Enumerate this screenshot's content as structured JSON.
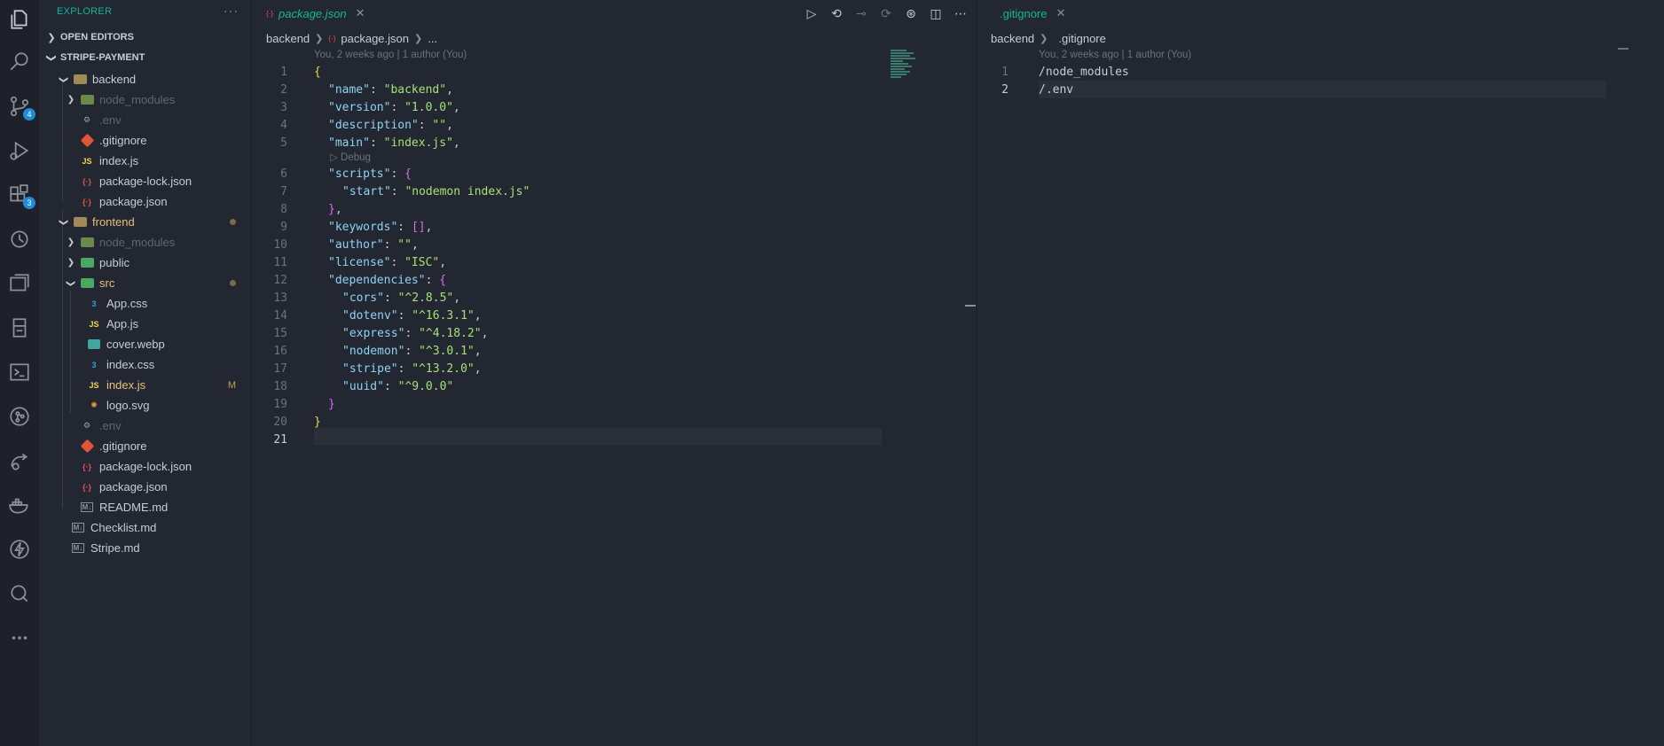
{
  "activity_bar": {
    "scm_badge": "4",
    "extensions_badge": "3"
  },
  "sidebar": {
    "title": "EXPLORER",
    "more": "···",
    "open_editors": "OPEN EDITORS",
    "workspace": "STRIPE-PAYMENT",
    "tree": [
      {
        "label": "backend"
      },
      {
        "label": "node_modules"
      },
      {
        "label": ".env"
      },
      {
        "label": ".gitignore"
      },
      {
        "label": "index.js"
      },
      {
        "label": "package-lock.json"
      },
      {
        "label": "package.json"
      },
      {
        "label": "frontend"
      },
      {
        "label": "node_modules"
      },
      {
        "label": "public"
      },
      {
        "label": "src"
      },
      {
        "label": "App.css"
      },
      {
        "label": "App.js"
      },
      {
        "label": "cover.webp"
      },
      {
        "label": "index.css"
      },
      {
        "label": "index.js",
        "flag": "M"
      },
      {
        "label": "logo.svg"
      },
      {
        "label": ".env"
      },
      {
        "label": ".gitignore"
      },
      {
        "label": "package-lock.json"
      },
      {
        "label": "package.json"
      },
      {
        "label": "README.md"
      },
      {
        "label": "Checklist.md"
      },
      {
        "label": "Stripe.md"
      }
    ]
  },
  "left_editor": {
    "tab_label": "package.json",
    "tab_close": "✕",
    "breadcrumb": [
      "backend",
      "package.json",
      "..."
    ],
    "blame": "You, 2 weeks ago | 1 author (You)",
    "codelens": "Debug",
    "line_numbers": [
      "1",
      "2",
      "3",
      "4",
      "5",
      "6",
      "7",
      "8",
      "9",
      "10",
      "11",
      "12",
      "13",
      "14",
      "15",
      "16",
      "17",
      "18",
      "19",
      "20",
      "21"
    ]
  },
  "right_editor": {
    "tab_label": ".gitignore",
    "tab_close": "✕",
    "breadcrumb": [
      "backend",
      ".gitignore"
    ],
    "blame": "You, 2 weeks ago | 1 author (You)",
    "line_numbers": [
      "1",
      "2"
    ],
    "lines": [
      "/node_modules",
      "/.env"
    ]
  },
  "code": {
    "l1": "{",
    "l2_k": "\"name\"",
    "l2_v": "\"backend\"",
    "l3_k": "\"version\"",
    "l3_v": "\"1.0.0\"",
    "l4_k": "\"description\"",
    "l4_v": "\"\"",
    "l5_k": "\"main\"",
    "l5_v": "\"index.js\"",
    "l6_k": "\"scripts\"",
    "l6_b": "{",
    "l7_k": "\"start\"",
    "l7_v": "\"nodemon index.js\"",
    "l8_b": "}",
    "l9_k": "\"keywords\"",
    "l9_v": "[]",
    "l10_k": "\"author\"",
    "l10_v": "\"\"",
    "l11_k": "\"license\"",
    "l11_v": "\"ISC\"",
    "l12_k": "\"dependencies\"",
    "l12_b": "{",
    "l13_k": "\"cors\"",
    "l13_v": "\"^2.8.5\"",
    "l14_k": "\"dotenv\"",
    "l14_v": "\"^16.3.1\"",
    "l15_k": "\"express\"",
    "l15_v": "\"^4.18.2\"",
    "l16_k": "\"nodemon\"",
    "l16_v": "\"^3.0.1\"",
    "l17_k": "\"stripe\"",
    "l17_v": "\"^13.2.0\"",
    "l18_k": "\"uuid\"",
    "l18_v": "\"^9.0.0\"",
    "l19_b": "}",
    "l20": "}"
  }
}
